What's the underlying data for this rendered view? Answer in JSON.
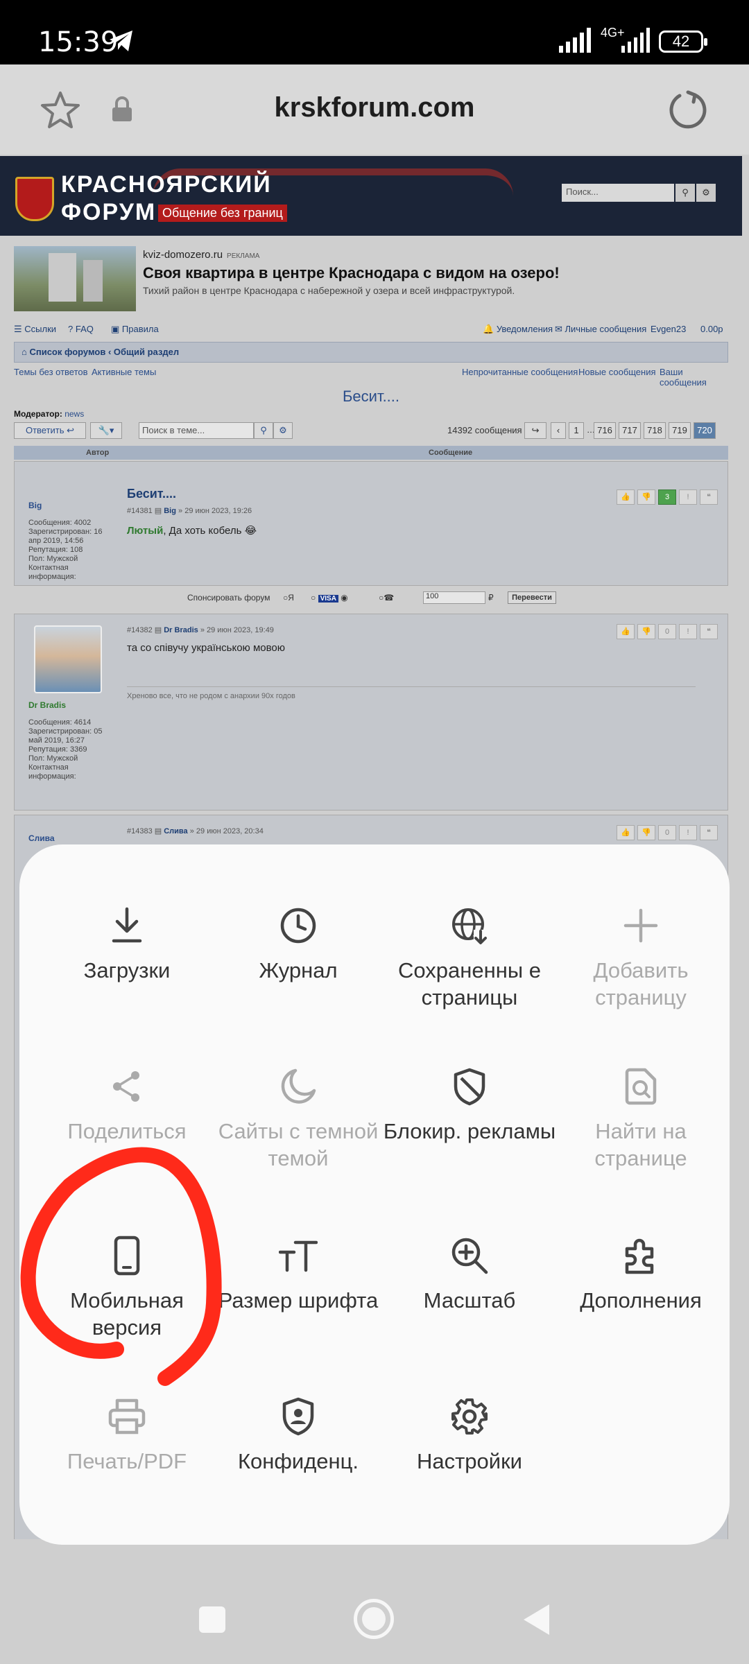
{
  "status_bar": {
    "time": "15:39",
    "network": "4G+",
    "battery": "42"
  },
  "browser": {
    "url": "krskforum.com"
  },
  "banner": {
    "title_line1": "КРАСНОЯРСКИЙ",
    "title_line2": "ФОРУМ",
    "subtitle": "Общение без границ",
    "search_placeholder": "Поиск..."
  },
  "ad": {
    "domain": "kviz-domozero.ru",
    "tag": "РЕКЛАМА",
    "title": "Своя квартира в центре Краснодара с видом на озеро!",
    "description": "Тихий район в центре Краснодара с набережной у озера и всей инфраструктурой."
  },
  "forum_nav": {
    "links": "Ссылки",
    "faq": "FAQ",
    "rules": "Правила",
    "notifications": "Уведомления",
    "messages": "Личные сообщения",
    "user": "Evgen23",
    "balance": "0.00р",
    "breadcrumb_home": "Список форумов",
    "breadcrumb_section": "Общий раздел",
    "no_replies": "Темы без ответов",
    "active": "Активные темы",
    "unread": "Непрочитанные сообщения",
    "new_msgs": "Новые сообщения",
    "your_msgs": "Ваши сообщения"
  },
  "topic": {
    "title": "Бесит....",
    "moderator_label": "Модератор:",
    "moderator": "news",
    "reply_button": "Ответить",
    "search_placeholder": "Поиск в теме...",
    "message_count": "14392 сообщения",
    "pages": [
      "1",
      "716",
      "717",
      "718",
      "719",
      "720"
    ],
    "ellipsis": "…",
    "col_author": "Автор",
    "col_message": "Сообщение"
  },
  "posts": [
    {
      "author": "Big",
      "meta": [
        "Сообщения: 4002",
        "Зарегистрирован: 16 апр 2019, 14:56",
        "Репутация: 108",
        "Пол: Мужской",
        "Контактная информация:"
      ],
      "subject": "Бесит....",
      "info_num": "#14381",
      "info_author": "Big",
      "info_date": "» 29 июн 2023, 19:26",
      "text_bold": "Лютый",
      "text": ", Да хоть кобель 😂",
      "rep": "3"
    },
    {
      "author": "Dr Bradis",
      "meta": [
        "Сообщения: 4614",
        "Зарегистрирован: 05 май 2019, 16:27",
        "Репутация: 3369",
        "Пол: Мужской",
        "Контактная информация:"
      ],
      "info_num": "#14382",
      "info_author": "Dr Bradis",
      "info_date": "» 29 июн 2023, 19:49",
      "text": "та со співучу українською мовою",
      "signature": "Хреново все, что не родом с анархии 90х годов",
      "rep": "0"
    },
    {
      "author": "Слива",
      "info_num": "#14383",
      "info_author": "Слива",
      "info_date": "» 29 июн 2023, 20:34",
      "rep": "0"
    }
  ],
  "sponsor": {
    "label": "Спонсировать форум",
    "amount": "100",
    "button": "Перевести"
  },
  "menu": {
    "items": [
      {
        "label": "Загрузки",
        "icon": "download-icon",
        "enabled": true
      },
      {
        "label": "Журнал",
        "icon": "clock-icon",
        "enabled": true
      },
      {
        "label": "Сохраненны е страницы",
        "icon": "globe-download-icon",
        "enabled": true
      },
      {
        "label": "Добавить страницу",
        "icon": "plus-icon",
        "enabled": false
      },
      {
        "label": "Поделиться",
        "icon": "share-icon",
        "enabled": false
      },
      {
        "label": "Сайты с темной темой",
        "icon": "moon-icon",
        "enabled": false
      },
      {
        "label": "Блокир. рекламы",
        "icon": "shield-slash-icon",
        "enabled": true
      },
      {
        "label": "Найти на странице",
        "icon": "find-page-icon",
        "enabled": false
      },
      {
        "label": "Мобильная версия",
        "icon": "phone-icon",
        "enabled": true
      },
      {
        "label": "Размер шрифта",
        "icon": "font-size-icon",
        "enabled": true
      },
      {
        "label": "Масштаб",
        "icon": "zoom-in-icon",
        "enabled": true
      },
      {
        "label": "Дополнения",
        "icon": "puzzle-icon",
        "enabled": true
      },
      {
        "label": "Печать/PDF",
        "icon": "printer-icon",
        "enabled": false
      },
      {
        "label": "Конфиденц.",
        "icon": "privacy-shield-icon",
        "enabled": true
      },
      {
        "label": "Настройки",
        "icon": "gear-icon",
        "enabled": true
      }
    ]
  },
  "colors": {
    "annotation": "#ff2a1a",
    "menu_bg": "#fafafa",
    "disabled": "#aaaaaa"
  }
}
